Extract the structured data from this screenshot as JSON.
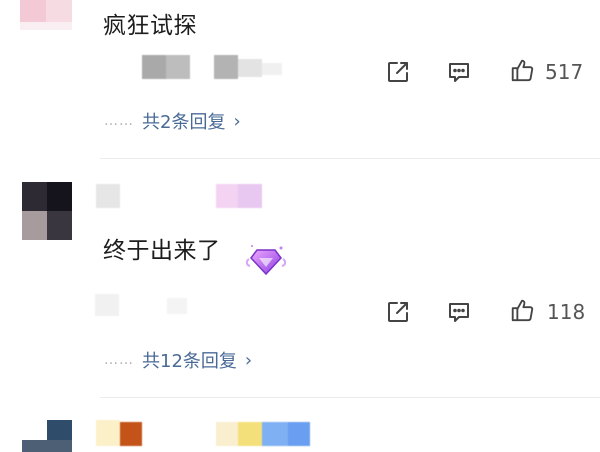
{
  "comments": [
    {
      "text": "疯狂试探",
      "like_count": "517",
      "replies_label": "共2条回复",
      "replies_dots": "……",
      "replies_chevron": "›"
    },
    {
      "text": "终于出来了",
      "like_count": "118",
      "replies_label": "共12条回复",
      "replies_dots": "……",
      "replies_chevron": "›",
      "badge_icon": "diamond-gem-badge"
    }
  ],
  "icons": {
    "share": "share-icon",
    "comment": "comment-icon",
    "like": "like-icon"
  },
  "colors": {
    "link": "#4a6a96",
    "text": "#1d1d1d",
    "muted": "#555555",
    "divider": "#ececec",
    "badge_purple": "#b85cf0"
  }
}
